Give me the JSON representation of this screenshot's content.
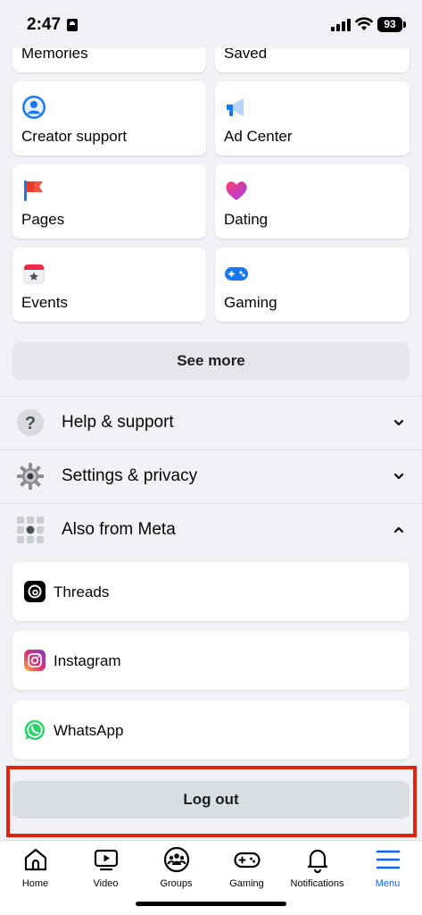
{
  "status_bar": {
    "time": "2:47",
    "battery": "93"
  },
  "shortcuts": {
    "partial_left": "Memories",
    "partial_right": "Saved",
    "items": [
      {
        "label": "Creator support",
        "icon": "creator-support-icon"
      },
      {
        "label": "Ad Center",
        "icon": "megaphone-icon"
      },
      {
        "label": "Pages",
        "icon": "flag-icon"
      },
      {
        "label": "Dating",
        "icon": "heart-icon"
      },
      {
        "label": "Events",
        "icon": "calendar-icon"
      },
      {
        "label": "Gaming",
        "icon": "gamepad-icon"
      }
    ],
    "see_more": "See more"
  },
  "sections": {
    "help": {
      "label": "Help & support",
      "icon": "question-icon",
      "state": "collapsed"
    },
    "settings": {
      "label": "Settings & privacy",
      "icon": "gear-icon",
      "state": "collapsed"
    },
    "meta": {
      "label": "Also from Meta",
      "icon": "grid-icon",
      "state": "expanded"
    }
  },
  "meta_apps": [
    {
      "label": "Threads",
      "icon": "threads-icon"
    },
    {
      "label": "Instagram",
      "icon": "instagram-icon"
    },
    {
      "label": "WhatsApp",
      "icon": "whatsapp-icon"
    }
  ],
  "logout": {
    "label": "Log out",
    "highlight_color": "#e02410"
  },
  "tabbar": {
    "active": "menu",
    "tabs": [
      {
        "label": "Home",
        "icon": "home-icon"
      },
      {
        "label": "Video",
        "icon": "video-icon"
      },
      {
        "label": "Groups",
        "icon": "groups-icon"
      },
      {
        "label": "Gaming",
        "icon": "gaming-tab-icon"
      },
      {
        "label": "Notifications",
        "icon": "bell-icon"
      },
      {
        "label": "Menu",
        "icon": "hamburger-icon"
      }
    ]
  },
  "colors": {
    "accent": "#0866ff",
    "background": "#f1f2f6",
    "card": "#ffffff"
  }
}
